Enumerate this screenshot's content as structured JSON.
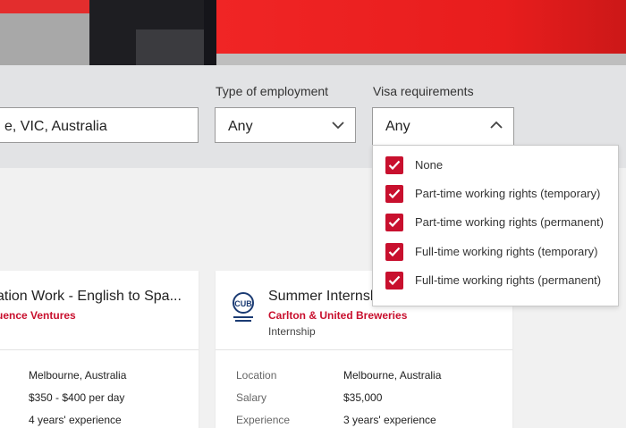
{
  "filters": {
    "location": {
      "value": "e, VIC, Australia"
    },
    "employment": {
      "label": "Type of employment",
      "value": "Any"
    },
    "visa": {
      "label": "Visa requirements",
      "value": "Any",
      "options": [
        {
          "label": "None",
          "checked": true
        },
        {
          "label": "Part-time working rights (temporary)",
          "checked": true
        },
        {
          "label": "Part-time working rights (permanent)",
          "checked": true
        },
        {
          "label": "Full-time working rights (temporary)",
          "checked": true
        },
        {
          "label": "Full-time working rights (permanent)",
          "checked": true
        }
      ]
    }
  },
  "cards": [
    {
      "title": "ation Work - English to Spa...",
      "company": "uence Ventures",
      "rows": [
        {
          "value": "Melbourne, Australia"
        },
        {
          "value": "$350 - $400 per day"
        },
        {
          "value": "4 years' experience"
        }
      ]
    },
    {
      "title": "Summer Internsh",
      "company": "Carlton & United Breweries",
      "type": "Internship",
      "logo_text": "CUB",
      "rows": [
        {
          "key": "Location",
          "value": "Melbourne, Australia"
        },
        {
          "key": "Salary",
          "value": "$35,000"
        },
        {
          "key": "Experience",
          "value": "3 years' experience"
        }
      ]
    }
  ],
  "colors": {
    "accent": "#c8102e",
    "filter_band": "#e2e3e5"
  }
}
